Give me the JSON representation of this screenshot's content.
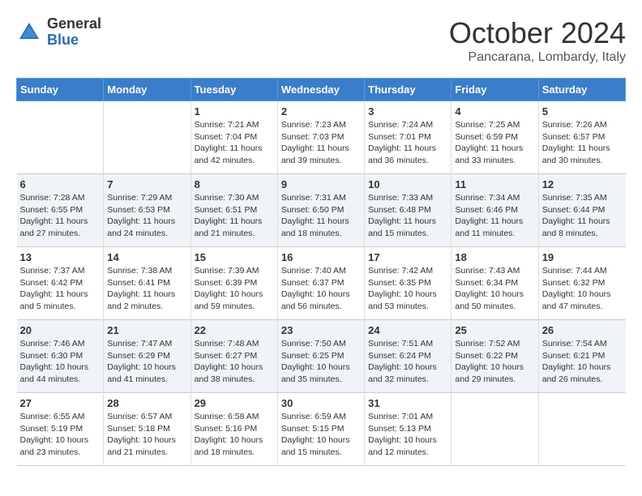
{
  "logo": {
    "general": "General",
    "blue": "Blue"
  },
  "title": "October 2024",
  "location": "Pancarana, Lombardy, Italy",
  "days_of_week": [
    "Sunday",
    "Monday",
    "Tuesday",
    "Wednesday",
    "Thursday",
    "Friday",
    "Saturday"
  ],
  "weeks": [
    [
      {
        "day": "",
        "content": ""
      },
      {
        "day": "",
        "content": ""
      },
      {
        "day": "1",
        "content": "Sunrise: 7:21 AM\nSunset: 7:04 PM\nDaylight: 11 hours and 42 minutes."
      },
      {
        "day": "2",
        "content": "Sunrise: 7:23 AM\nSunset: 7:03 PM\nDaylight: 11 hours and 39 minutes."
      },
      {
        "day": "3",
        "content": "Sunrise: 7:24 AM\nSunset: 7:01 PM\nDaylight: 11 hours and 36 minutes."
      },
      {
        "day": "4",
        "content": "Sunrise: 7:25 AM\nSunset: 6:59 PM\nDaylight: 11 hours and 33 minutes."
      },
      {
        "day": "5",
        "content": "Sunrise: 7:26 AM\nSunset: 6:57 PM\nDaylight: 11 hours and 30 minutes."
      }
    ],
    [
      {
        "day": "6",
        "content": "Sunrise: 7:28 AM\nSunset: 6:55 PM\nDaylight: 11 hours and 27 minutes."
      },
      {
        "day": "7",
        "content": "Sunrise: 7:29 AM\nSunset: 6:53 PM\nDaylight: 11 hours and 24 minutes."
      },
      {
        "day": "8",
        "content": "Sunrise: 7:30 AM\nSunset: 6:51 PM\nDaylight: 11 hours and 21 minutes."
      },
      {
        "day": "9",
        "content": "Sunrise: 7:31 AM\nSunset: 6:50 PM\nDaylight: 11 hours and 18 minutes."
      },
      {
        "day": "10",
        "content": "Sunrise: 7:33 AM\nSunset: 6:48 PM\nDaylight: 11 hours and 15 minutes."
      },
      {
        "day": "11",
        "content": "Sunrise: 7:34 AM\nSunset: 6:46 PM\nDaylight: 11 hours and 11 minutes."
      },
      {
        "day": "12",
        "content": "Sunrise: 7:35 AM\nSunset: 6:44 PM\nDaylight: 11 hours and 8 minutes."
      }
    ],
    [
      {
        "day": "13",
        "content": "Sunrise: 7:37 AM\nSunset: 6:42 PM\nDaylight: 11 hours and 5 minutes."
      },
      {
        "day": "14",
        "content": "Sunrise: 7:38 AM\nSunset: 6:41 PM\nDaylight: 11 hours and 2 minutes."
      },
      {
        "day": "15",
        "content": "Sunrise: 7:39 AM\nSunset: 6:39 PM\nDaylight: 10 hours and 59 minutes."
      },
      {
        "day": "16",
        "content": "Sunrise: 7:40 AM\nSunset: 6:37 PM\nDaylight: 10 hours and 56 minutes."
      },
      {
        "day": "17",
        "content": "Sunrise: 7:42 AM\nSunset: 6:35 PM\nDaylight: 10 hours and 53 minutes."
      },
      {
        "day": "18",
        "content": "Sunrise: 7:43 AM\nSunset: 6:34 PM\nDaylight: 10 hours and 50 minutes."
      },
      {
        "day": "19",
        "content": "Sunrise: 7:44 AM\nSunset: 6:32 PM\nDaylight: 10 hours and 47 minutes."
      }
    ],
    [
      {
        "day": "20",
        "content": "Sunrise: 7:46 AM\nSunset: 6:30 PM\nDaylight: 10 hours and 44 minutes."
      },
      {
        "day": "21",
        "content": "Sunrise: 7:47 AM\nSunset: 6:29 PM\nDaylight: 10 hours and 41 minutes."
      },
      {
        "day": "22",
        "content": "Sunrise: 7:48 AM\nSunset: 6:27 PM\nDaylight: 10 hours and 38 minutes."
      },
      {
        "day": "23",
        "content": "Sunrise: 7:50 AM\nSunset: 6:25 PM\nDaylight: 10 hours and 35 minutes."
      },
      {
        "day": "24",
        "content": "Sunrise: 7:51 AM\nSunset: 6:24 PM\nDaylight: 10 hours and 32 minutes."
      },
      {
        "day": "25",
        "content": "Sunrise: 7:52 AM\nSunset: 6:22 PM\nDaylight: 10 hours and 29 minutes."
      },
      {
        "day": "26",
        "content": "Sunrise: 7:54 AM\nSunset: 6:21 PM\nDaylight: 10 hours and 26 minutes."
      }
    ],
    [
      {
        "day": "27",
        "content": "Sunrise: 6:55 AM\nSunset: 5:19 PM\nDaylight: 10 hours and 23 minutes."
      },
      {
        "day": "28",
        "content": "Sunrise: 6:57 AM\nSunset: 5:18 PM\nDaylight: 10 hours and 21 minutes."
      },
      {
        "day": "29",
        "content": "Sunrise: 6:58 AM\nSunset: 5:16 PM\nDaylight: 10 hours and 18 minutes."
      },
      {
        "day": "30",
        "content": "Sunrise: 6:59 AM\nSunset: 5:15 PM\nDaylight: 10 hours and 15 minutes."
      },
      {
        "day": "31",
        "content": "Sunrise: 7:01 AM\nSunset: 5:13 PM\nDaylight: 10 hours and 12 minutes."
      },
      {
        "day": "",
        "content": ""
      },
      {
        "day": "",
        "content": ""
      }
    ]
  ]
}
